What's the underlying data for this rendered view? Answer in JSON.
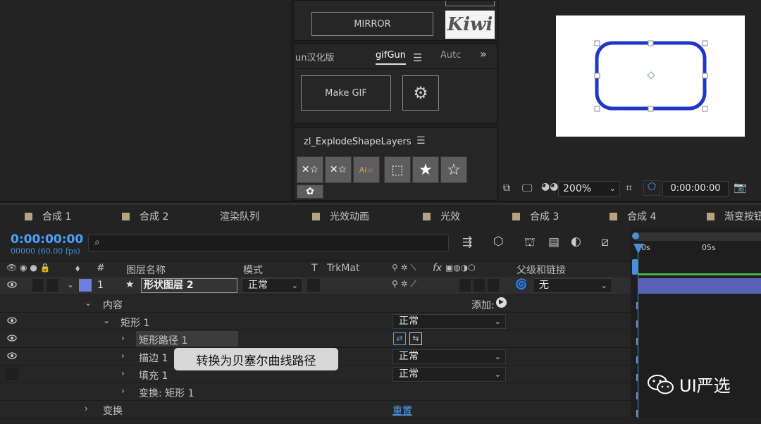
{
  "effects_panel": {
    "mirror_label": "MIRROR",
    "kiwi_logo": "Kiwi",
    "tabs": [
      "un汉化版",
      "gifGun",
      "Autc"
    ],
    "tab_menu_icon": "hamburger-icon",
    "more_icon": "double-chevron-right-icon",
    "make_gif_label": "Make GIF",
    "settings_icon": "gear-icon",
    "explode_title": "zl_ExplodeShapeLayers",
    "explode_tiles": [
      "explode-star-icon",
      "explode-star-icon",
      "ai-star-icon",
      "selection-box-icon",
      "star-filled-icon",
      "star-outline-icon",
      "flower-icon"
    ]
  },
  "viewer": {
    "zoom": "200%",
    "timecode": "0:00:00:00",
    "shape_color": "#1f37c7"
  },
  "comp_tabs": [
    {
      "label": "合成 1",
      "swatch": true
    },
    {
      "label": "合成 2",
      "swatch": true
    },
    {
      "label": "渲染队列",
      "swatch": false
    },
    {
      "label": "光效动画",
      "swatch": true
    },
    {
      "label": "光效",
      "swatch": true
    },
    {
      "label": "合成 3",
      "swatch": true
    },
    {
      "label": "合成 4",
      "swatch": true
    },
    {
      "label": "渐变按钮",
      "swatch": true
    }
  ],
  "timeline": {
    "timecode": "0:00:00:00",
    "fps": "00000 (60.00 fps)",
    "search_icon": "search-icon",
    "columns": {
      "number": "#",
      "layer_name": "图层名称",
      "mode": "模式",
      "t": "T",
      "trkmat": "TrkMat",
      "switches": "fx",
      "parent": "父级和链接"
    },
    "ruler": [
      "00s",
      "05s"
    ],
    "layer": {
      "index": "1",
      "name": "形状图层 2",
      "mode": "正常",
      "parent": "无",
      "color": "#6f7fe0"
    },
    "rows": [
      {
        "label": "内容",
        "add_label": "添加:"
      },
      {
        "label": "矩形 1",
        "mode": "正常"
      },
      {
        "label": "矩形路径 1"
      },
      {
        "label": "描边 1",
        "mode": "正常"
      },
      {
        "label": "填充 1",
        "mode": "正常"
      },
      {
        "label": "变换: 矩形 1"
      },
      {
        "label": "变换",
        "reset_label": "重置"
      }
    ]
  },
  "tooltip": "转换为贝塞尔曲线路径",
  "watermark": "UI严选"
}
